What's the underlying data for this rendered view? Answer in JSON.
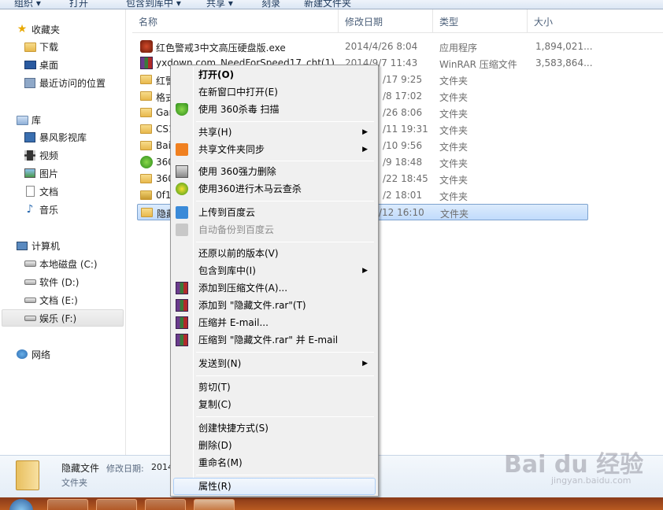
{
  "toolbar": {
    "organize": "组织 ▾",
    "open": "打开",
    "include": "包含到库中 ▾",
    "share": "共享 ▾",
    "burn": "刻录",
    "new_folder": "新建文件夹"
  },
  "sidebar": {
    "favorites": "收藏夹",
    "favorites_items": [
      "下载",
      "桌面",
      "最近访问的位置"
    ],
    "libraries": "库",
    "library_items": [
      "暴风影视库",
      "视频",
      "图片",
      "文档",
      "音乐"
    ],
    "computer": "计算机",
    "drives": [
      "本地磁盘 (C:)",
      "软件 (D:)",
      "文档 (E:)",
      "娱乐 (F:)"
    ],
    "network": "网络"
  },
  "columns": {
    "name": "名称",
    "date": "修改日期",
    "type": "类型",
    "size": "大小"
  },
  "files": [
    {
      "name": "红色警戒3中文高压硬盘版.exe",
      "date": "2014/4/26 8:04",
      "type": "应用程序",
      "size": "1,894,021...",
      "icon": "exe-icon"
    },
    {
      "name": "yxdown.com_NeedForSpeed17_cht(1)...",
      "date": "2014/9/7 11:43",
      "type": "WinRAR 压缩文件",
      "size": "3,583,864...",
      "icon": "rar-icon"
    },
    {
      "name": "红警",
      "date": "/17 9:25",
      "type": "文件夹",
      "size": "",
      "icon": "folder-icon"
    },
    {
      "name": "格式",
      "date": "/8 17:02",
      "type": "文件夹",
      "size": "",
      "icon": "folder-icon"
    },
    {
      "name": "Gar",
      "date": "/26 8:06",
      "type": "文件夹",
      "size": "",
      "icon": "folder-icon"
    },
    {
      "name": "CS1",
      "date": "/11 19:31",
      "type": "文件夹",
      "size": "",
      "icon": "folder-icon"
    },
    {
      "name": "Bai",
      "date": "/10 9:56",
      "type": "文件夹",
      "size": "",
      "icon": "folder-icon"
    },
    {
      "name": "360",
      "date": "/9 18:48",
      "type": "文件夹",
      "size": "",
      "icon": "green-folder-icon"
    },
    {
      "name": "360",
      "date": "/22 18:45",
      "type": "文件夹",
      "size": "",
      "icon": "folder-icon"
    },
    {
      "name": "0f1",
      "date": "/2 18:01",
      "type": "文件夹",
      "size": "",
      "icon": "locked-folder-icon"
    },
    {
      "name": "隐藏",
      "date": "/12 16:10",
      "type": "文件夹",
      "size": "",
      "icon": "folder-icon"
    }
  ],
  "context_menu": {
    "open": "打开(O)",
    "open_new_window": "在新窗口中打开(E)",
    "scan_360": "使用 360杀毒 扫描",
    "share": "共享(H)",
    "share_sync": "共享文件夹同步",
    "force_delete": "使用 360强力删除",
    "trojan_scan": "使用360进行木马云查杀",
    "upload_baidu": "上传到百度云",
    "auto_backup": "自动备份到百度云",
    "restore": "还原以前的版本(V)",
    "include_library": "包含到库中(I)",
    "add_archive": "添加到压缩文件(A)...",
    "add_rar": "添加到 \"隐藏文件.rar\"(T)",
    "compress_email": "压缩并 E-mail...",
    "compress_rar_email": "压缩到 \"隐藏文件.rar\" 并 E-mail",
    "send_to": "发送到(N)",
    "cut": "剪切(T)",
    "copy": "复制(C)",
    "create_shortcut": "创建快捷方式(S)",
    "delete": "删除(D)",
    "rename": "重命名(M)",
    "properties": "属性(R)"
  },
  "details": {
    "name": "隐藏文件",
    "modified_label": "修改日期:",
    "modified_value": "2014",
    "type": "文件夹"
  },
  "watermark": {
    "brand": "Bai du 经验",
    "url": "jingyan.baidu.com"
  },
  "colors": {
    "selection": "#cce4fc",
    "menu_bg": "#f0f0f0",
    "taskbar": "#a04a1c"
  }
}
